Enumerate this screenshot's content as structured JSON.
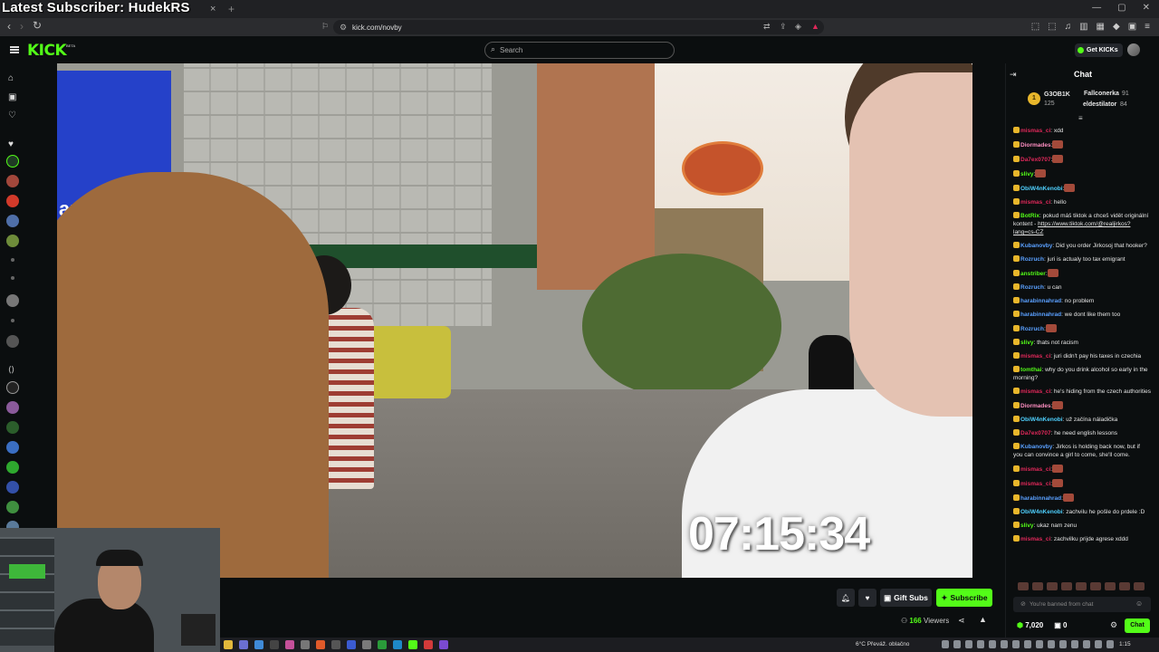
{
  "overlay": {
    "title": "Latest Subscriber: HudekRS",
    "timer": "07:15:34"
  },
  "browser": {
    "tab_close": "×",
    "tab_new": "+",
    "url": "kick.com/novby",
    "nav": {
      "back": "‹",
      "forward": "›",
      "reload": "↻"
    }
  },
  "header": {
    "logo": "KICK",
    "logo_sup": "BETA",
    "search_placeholder": "Search",
    "get_kicks": "Get KICKs"
  },
  "video_sign_text": "autv",
  "actions": {
    "gift_subs": "Gift Subs",
    "subscribe": "Subscribe",
    "viewers_count": "166",
    "viewers_label": "Viewers"
  },
  "chat": {
    "title": "Chat",
    "leaderboard": [
      {
        "name": "G3OB1K",
        "score": "125",
        "color": "#e8b62b"
      },
      {
        "name": "Fallconerka",
        "score": "91",
        "color": "#e8b62b"
      },
      {
        "name": "eldestilator",
        "score": "84",
        "color": "#e8b62b"
      }
    ],
    "messages": [
      {
        "user": "mismas_ci",
        "color": "#e0285a",
        "text": ": xdd"
      },
      {
        "user": "Diormades",
        "color": "#ff8fc2",
        "text": ":"
      },
      {
        "user": "Da7ex0707",
        "color": "#e0285a",
        "text": ":"
      },
      {
        "user": "slivy",
        "color": "#53fc18",
        "text": ":"
      },
      {
        "user": "ObiW4nKenobi",
        "color": "#4fd1ff",
        "text": ":"
      },
      {
        "user": "mismas_ci",
        "color": "#e0285a",
        "text": ": hello"
      },
      {
        "user": "BotRix",
        "color": "#53fc18",
        "text": ": pokud máš tiktok a chceš vidět originální kontent - ",
        "link": "https://www.tiktok.com/@realjirkos?lang=cs-CZ"
      },
      {
        "user": "Kubanovby",
        "color": "#5aa0ff",
        "text": ": Did you order Jirkosoj that hooker?"
      },
      {
        "user": "Rozruch",
        "color": "#5aa0ff",
        "text": ": juri is actualy too tax emigrant"
      },
      {
        "user": "anstriber",
        "color": "#53fc18",
        "text": ":"
      },
      {
        "user": "Rozruch",
        "color": "#5aa0ff",
        "text": ": u can"
      },
      {
        "user": "harabinnahrad",
        "color": "#5aa0ff",
        "text": ": no problem"
      },
      {
        "user": "harabinnahrad",
        "color": "#5aa0ff",
        "text": ": we dont like them too"
      },
      {
        "user": "Rozruch",
        "color": "#5aa0ff",
        "text": ":"
      },
      {
        "user": "slivy",
        "color": "#53fc18",
        "text": ": thats not racism"
      },
      {
        "user": "mismas_ci",
        "color": "#e0285a",
        "text": ": juri didn't pay his taxes in czechia"
      },
      {
        "user": "tomthai",
        "color": "#53fc18",
        "text": ": why do you drink alcohol so early in the morning?"
      },
      {
        "user": "mismas_ci",
        "color": "#e0285a",
        "text": ": he's hiding from the czech authorities"
      },
      {
        "user": "Diormades",
        "color": "#ff8fc2",
        "text": ":"
      },
      {
        "user": "ObiW4nKenobi",
        "color": "#4fd1ff",
        "text": ": už začína náladička"
      },
      {
        "user": "Da7ex0707",
        "color": "#e0285a",
        "text": ": he need english lessons"
      },
      {
        "user": "Kubanovby",
        "color": "#5aa0ff",
        "text": ": Jirkos is holding back now, but if you can convince a girl to come, she'll come."
      },
      {
        "user": "mismas_ci",
        "color": "#e0285a",
        "text": ":"
      },
      {
        "user": "mismas_ci",
        "color": "#e0285a",
        "text": ":"
      },
      {
        "user": "harabinnahrad",
        "color": "#5aa0ff",
        "text": ":"
      },
      {
        "user": "ObiW4nKenobi",
        "color": "#4fd1ff",
        "text": ": zachvilu he pošle do prdele :D"
      },
      {
        "user": "slivy",
        "color": "#53fc18",
        "text": ": ukaz nam zenu"
      },
      {
        "user": "mismas_ci",
        "color": "#e0285a",
        "text": ": zachvilku prijde agrese xddd"
      }
    ],
    "banned_placeholder": "You're banned from chat",
    "kicks_balance": "7,020",
    "gifts_count": "0",
    "chat_button": "Chat"
  },
  "taskbar": {
    "weather": "6°C  Převáž. oblačno",
    "time": "1:15"
  },
  "colors": {
    "accent": "#53fc18",
    "bg": "#0b0e0f",
    "panel": "#24272c"
  }
}
